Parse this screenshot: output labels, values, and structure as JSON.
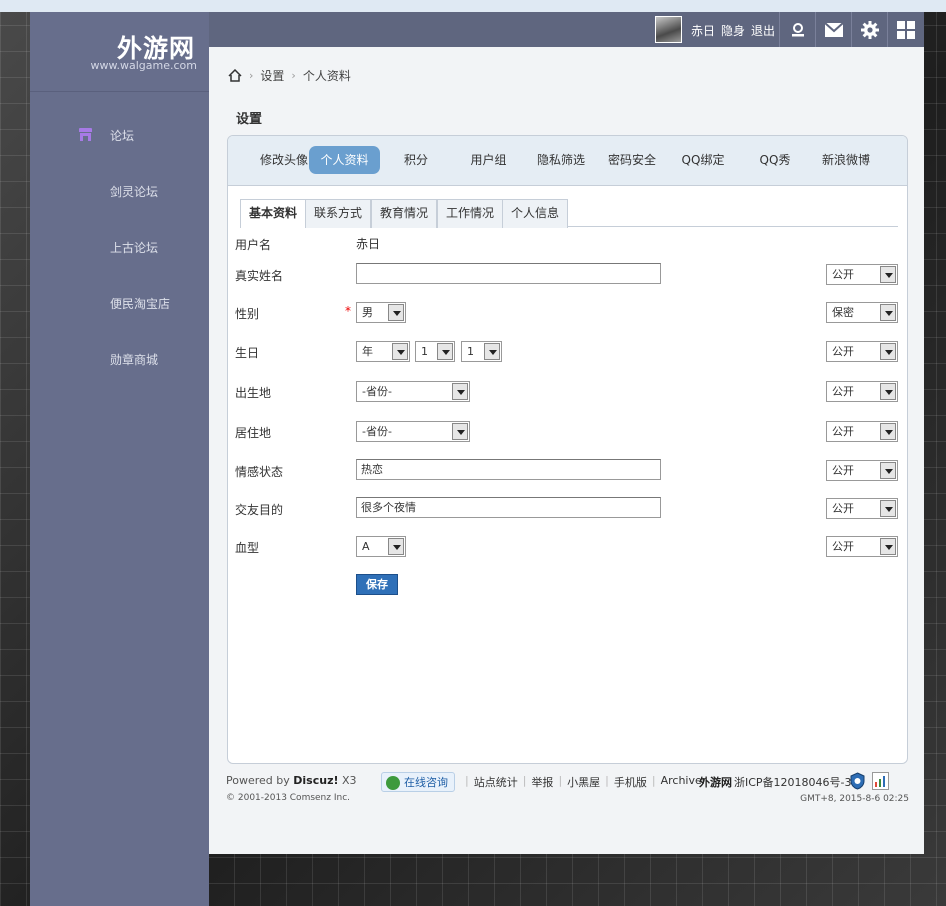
{
  "site": {
    "title": "外游网",
    "url": "www.walgame.com"
  },
  "sidebar": {
    "items": [
      {
        "label": "论坛"
      },
      {
        "label": "剑灵论坛"
      },
      {
        "label": "上古论坛"
      },
      {
        "label": "便民淘宝店"
      },
      {
        "label": "勋章商城"
      }
    ]
  },
  "topbar": {
    "username": "赤日",
    "invisible": "隐身",
    "logout": "退出"
  },
  "breadcrumb": {
    "home_icon": "home-icon",
    "items": [
      "设置",
      "个人资料"
    ]
  },
  "page_title": "设置",
  "tabs": [
    "修改头像",
    "个人资料",
    "积分",
    "用户组",
    "隐私筛选",
    "密码安全",
    "QQ绑定",
    "QQ秀",
    "新浪微博"
  ],
  "active_tab": "个人资料",
  "subtabs": [
    "基本资料",
    "联系方式",
    "教育情况",
    "工作情况",
    "个人信息"
  ],
  "active_subtab": "基本资料",
  "form": {
    "username_label": "用户名",
    "username_value": "赤日",
    "realname_label": "真实姓名",
    "realname_value": "",
    "gender_label": "性别",
    "gender_required": "*",
    "gender_value": "男",
    "birthday_label": "生日",
    "birth_year": "年",
    "birth_month": "1",
    "birth_day": "1",
    "birthplace_label": "出生地",
    "birthplace_value": "-省份-",
    "residence_label": "居住地",
    "residence_value": "-省份-",
    "affective_label": "情感状态",
    "affective_value": "热恋",
    "lookingfor_label": "交友目的",
    "lookingfor_value": "很多个夜情",
    "bloodtype_label": "血型",
    "bloodtype_value": "A",
    "privacy": {
      "realname": "公开",
      "gender": "保密",
      "birthday": "公开",
      "birthplace": "公开",
      "residence": "公开",
      "affective": "公开",
      "lookingfor": "公开",
      "bloodtype": "公开"
    },
    "save_label": "保存"
  },
  "footer": {
    "powered_by": "Powered by",
    "discuz": "Discuz!",
    "version": "X3",
    "copyright": "© 2001-2013 Comsenz Inc.",
    "consult": "在线咨询",
    "links": [
      "站点统计",
      "举报",
      "小黑屋",
      "手机版",
      "Archiver"
    ],
    "site_name": "外游网",
    "icp": "浙ICP备12018046号-3",
    "timestamp": "GMT+8, 2015-8-6 02:25"
  },
  "colors": {
    "sidebar_bg": "#676e8c",
    "topbar_bg": "#5f667f",
    "active_tab": "#6a9fcf",
    "save_button": "#2f70b8"
  }
}
